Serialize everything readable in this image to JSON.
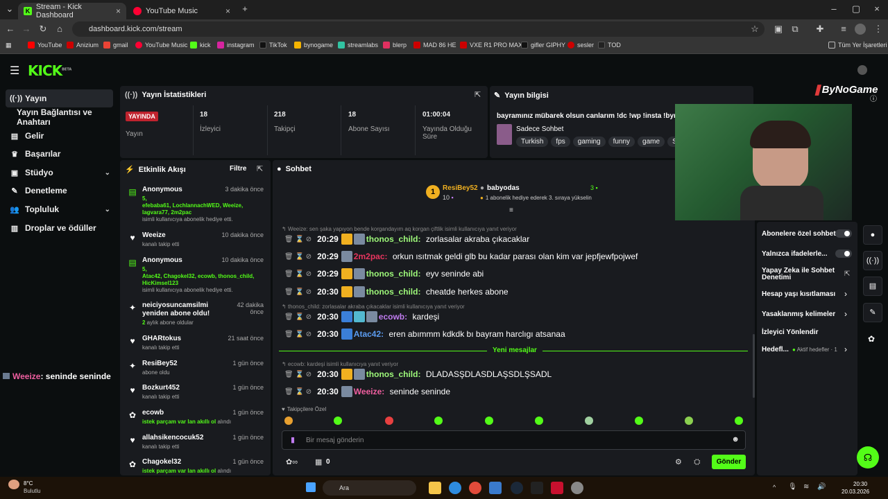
{
  "browser": {
    "tabs": [
      {
        "title": "Stream - Kick Dashboard"
      },
      {
        "title": "YouTube Music"
      }
    ],
    "url": "dashboard.kick.com/stream",
    "bookmarks": [
      "YouTube",
      "Anizium",
      "gmail",
      "YouTube Music",
      "kick",
      "instagram",
      "TikTok",
      "bynogame",
      "streamlabs",
      "blerp",
      "MAD 86 HE",
      "VXE R1 PRO MAX",
      "gifler GIPHY",
      "sesler",
      "TOD"
    ],
    "all_bookmarks": "Tüm Yer İşaretleri"
  },
  "kick": {
    "logo": "KICK",
    "beta": "BETA",
    "sidebar": [
      {
        "label": "Yayın"
      },
      {
        "label": "Yayın Bağlantısı ve Anahtarı"
      },
      {
        "label": "Gelir"
      },
      {
        "label": "Başarılar"
      },
      {
        "label": "Stüdyo"
      },
      {
        "label": "Denetleme"
      },
      {
        "label": "Topluluk"
      },
      {
        "label": "Droplar ve ödüller"
      }
    ],
    "overlay_chat": {
      "user": "Weeize",
      "text": ": seninde seninde"
    },
    "stats": {
      "title": "Yayın İstatistikleri",
      "live_badge": "YAYINDA",
      "live_label": "Yayın",
      "items": [
        {
          "value": "18",
          "label": "İzleyici"
        },
        {
          "value": "218",
          "label": "Takipçi"
        },
        {
          "value": "18",
          "label": "Abone Sayısı"
        },
        {
          "value": "01:00:04",
          "label": "Yayında Olduğu Süre"
        }
      ]
    },
    "info": {
      "title": "Yayın bilgisi",
      "stream_title": "bayramınız mübarek olsun canlarım !dc !wp !insta !bynog",
      "category": "Sadece Sohbet",
      "tags": [
        "Turkish",
        "fps",
        "gaming",
        "funny",
        "game",
        "Soh"
      ]
    },
    "activity": {
      "title": "Etkinlik Akışı",
      "filter": "Filtre",
      "events": [
        {
          "name": "Anonymous",
          "time": "3 dakika önce",
          "count": "5,",
          "users": "efebaba61, LochlannachWED, Weeize, lagvara77, 2m2pac",
          "desc": "isimli kullanıcıya abonelik hediye etti."
        },
        {
          "name": "Weeize",
          "time": "10 dakika önce",
          "desc": "kanalı takip etti"
        },
        {
          "name": "Anonymous",
          "time": "10 dakika önce",
          "count": "5,",
          "users": "Atac42, Chagokel32, ecowb, thonos_child, HicKimsel123",
          "desc": "isimli kullanıcıya abonelik hediye etti."
        },
        {
          "name": "neiciyosuncamsilmi yeniden abone oldu!",
          "time": "42 dakika önce",
          "green": "2",
          "desc": " aylık abone oldular"
        },
        {
          "name": "GHARtokus",
          "time": "21 saat önce",
          "desc": "kanalı takip etti"
        },
        {
          "name": "ResiBey52",
          "time": "1 gün önce",
          "desc": "abone oldu"
        },
        {
          "name": "Bozkurt452",
          "time": "1 gün önce",
          "desc": "kanalı takip etti"
        },
        {
          "name": "ecowb",
          "time": "1 gün önce",
          "green": "istek parçam var lan akıllı ol",
          "desc": " alındı"
        },
        {
          "name": "allahsikencocuk52",
          "time": "1 gün önce",
          "desc": "kanalı takip etti"
        },
        {
          "name": "Chagokel32",
          "time": "1 gün önce",
          "green": "istek parçam var lan akıllı ol",
          "desc": " alındı"
        }
      ]
    },
    "chat": {
      "title": "Sohbet",
      "top_user": "ResiBey52",
      "top_rank": "1",
      "top_points": "10",
      "gift_user": "babyodas",
      "gift_count": "3",
      "gift_desc": "1 abonelik hediye ederek 3. sıraya yükselin",
      "messages": [
        {
          "reply": "Weeize: sen şaka yapıyon bende korgandayım aq korgan çiftlik isimli kullanıcıya yanıt veriyor"
        },
        {
          "time": "20:29",
          "user": "thonos_child:",
          "color": "#9ef97a",
          "text": "zorlasalar akraba çıkacaklar"
        },
        {
          "time": "20:29",
          "user": "2m2pac:",
          "color": "#e8355f",
          "text": "orkun ısıtmak geldi glb bu kadar parası olan kim var jepfjewfpojwef"
        },
        {
          "time": "20:29",
          "user": "thonos_child:",
          "color": "#9ef97a",
          "text": "eyv seninde abi"
        },
        {
          "time": "20:30",
          "user": "thonos_child:",
          "color": "#9ef97a",
          "text": "cheatde herkes abone"
        },
        {
          "reply": "thonos_child: zorlasalar akraba çıkacaklar isimli kullanıcıya yanıt veriyor"
        },
        {
          "time": "20:30",
          "user": "ecowb:",
          "color": "#c07cf0",
          "text": "kardeşi"
        },
        {
          "time": "20:30",
          "user": "Atac42:",
          "color": "#5b9cf0",
          "text": "eren abımmm kdkdk bı bayram harclıgı atsanaa"
        },
        {
          "reply": "ecowb: kardeşi isimli kullanıcıya yanıt veriyor"
        },
        {
          "time": "20:30",
          "user": "thonos_child:",
          "color": "#9ef97a",
          "text": "DLADASŞDLASDLAŞSDLŞSADL"
        },
        {
          "time": "20:30",
          "user": "Weeize:",
          "color": "#f05fa0",
          "text": "seninde seninde"
        }
      ],
      "new_messages": "Yeni mesajlar",
      "followers_only": "Takipçilere Özel",
      "placeholder": "Bir mesaj gönderin",
      "send": "Gönder",
      "points": "0"
    },
    "settings": [
      {
        "label": "Abonelere özel sohbet"
      },
      {
        "label": "Yalnızca ifadelerle..."
      },
      {
        "label": "Yapay Zeka ile Sohbet Denetimi"
      },
      {
        "label": "Hesap yaşı kısıtlaması"
      },
      {
        "label": "Yasaklanmış kelimeler"
      },
      {
        "label": "İzleyici Yönlendir"
      },
      {
        "label": "Hedefl..."
      }
    ],
    "goal_status": "Aktif hedefler · 1",
    "watermark": "ByNoGame"
  },
  "taskbar": {
    "weather_temp": "8°C",
    "weather_desc": "Bulutlu",
    "search": "Ara",
    "time": "20:30",
    "date": "20.03.2026"
  }
}
